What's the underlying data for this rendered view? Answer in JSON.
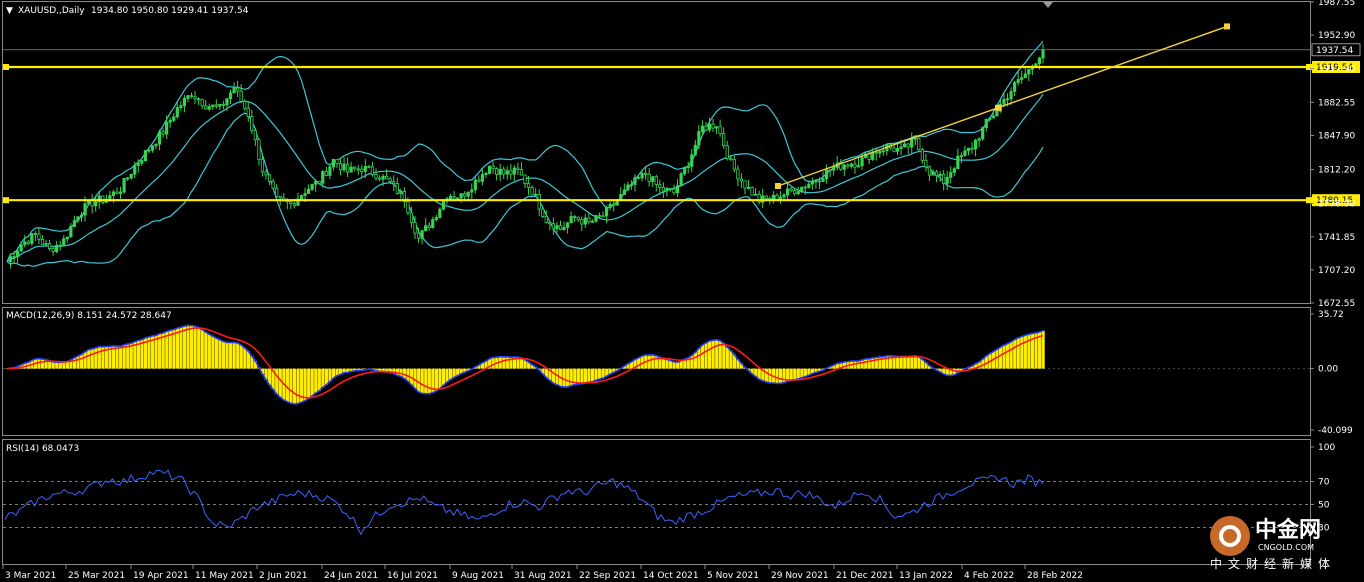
{
  "header": {
    "symbol_label": "XAUUSD,,Daily",
    "ohlc_label": "1934.80 1950.80 1929.41 1937.54",
    "macd_label": "MACD(12,26,9) 8.151 24.572 28.647",
    "rsi_label": "RSI(14) 68.0473"
  },
  "price_axis": {
    "ticks": [
      "1987.55",
      "1952.90",
      "1917.90",
      "1882.55",
      "1847.90",
      "1812.20",
      "1776.90",
      "1741.85",
      "1707.20",
      "1672.55"
    ],
    "tick_values": [
      1987.55,
      1952.9,
      1917.9,
      1882.55,
      1847.9,
      1812.2,
      1776.9,
      1741.85,
      1707.2,
      1672.55
    ],
    "current_label": "1937.54",
    "current_value": 1937.54,
    "level_high_label": "1919.54",
    "level_high_value": 1919.54,
    "level_low_label": "1780.15",
    "level_low_value": 1780.15
  },
  "macd_axis": {
    "ticks": [
      "35.72",
      "0.00",
      "-40.099"
    ],
    "values": [
      35.72,
      0,
      -40.099
    ]
  },
  "rsi_axis": {
    "ticks": [
      "100",
      "70",
      "50",
      "30"
    ],
    "values": [
      100,
      70,
      50,
      30
    ]
  },
  "date_axis": [
    "3 Mar 2021",
    "25 Mar 2021",
    "19 Apr 2021",
    "11 May 2021",
    "2 Jun 2021",
    "24 Jun 2021",
    "16 Jul 2021",
    "9 Aug 2021",
    "31 Aug 2021",
    "22 Sep 2021",
    "14 Oct 2021",
    "5 Nov 2021",
    "29 Nov 2021",
    "21 Dec 2021",
    "13 Jan 2022",
    "4 Feb 2022",
    "28 Feb 2022"
  ],
  "watermark": {
    "brand_cn": "中金网",
    "brand_en": "CNGOLD.COM",
    "sub_cn": "中文财经新媒体"
  },
  "colors": {
    "background": "#000000",
    "grid": "#3a3a3a",
    "candles": "#39d353",
    "bollinger": "#3cc8d8",
    "level_lines": "#ffee00",
    "trendline": "#f5d23c",
    "macd_hist": "#ffee00",
    "macd_line": "#1e3cff",
    "signal_line": "#ff1a1a",
    "rsi_line": "#3b63ff"
  },
  "chart_data": {
    "type": "candlestick",
    "symbol": "XAUUSD",
    "timeframe": "Daily",
    "ohlc_last": {
      "open": 1934.8,
      "high": 1950.8,
      "low": 1929.41,
      "close": 1937.54
    },
    "x_dates": [
      "3 Mar 2021",
      "25 Mar 2021",
      "19 Apr 2021",
      "11 May 2021",
      "2 Jun 2021",
      "24 Jun 2021",
      "16 Jul 2021",
      "9 Aug 2021",
      "31 Aug 2021",
      "22 Sep 2021",
      "14 Oct 2021",
      "5 Nov 2021",
      "29 Nov 2021",
      "21 Dec 2021",
      "13 Jan 2022",
      "4 Feb 2022",
      "28 Feb 2022"
    ],
    "close_approx": [
      1716,
      1734,
      1744,
      1728,
      1738,
      1766,
      1778,
      1782,
      1792,
      1816,
      1834,
      1852,
      1876,
      1892,
      1880,
      1876,
      1898,
      1870,
      1812,
      1780,
      1776,
      1790,
      1800,
      1822,
      1810,
      1814,
      1808,
      1798,
      1782,
      1740,
      1760,
      1786,
      1784,
      1800,
      1816,
      1808,
      1810,
      1790,
      1760,
      1750,
      1762,
      1756,
      1764,
      1780,
      1796,
      1808,
      1792,
      1788,
      1820,
      1856,
      1860,
      1818,
      1796,
      1780,
      1782,
      1788,
      1794,
      1802,
      1812,
      1818,
      1820,
      1830,
      1836,
      1832,
      1842,
      1810,
      1800,
      1822,
      1836,
      1860,
      1880,
      1900,
      1916,
      1938
    ],
    "ylim": [
      1672.55,
      1987.55
    ],
    "horizontal_levels": [
      1919.54,
      1780.15
    ],
    "trendline": {
      "start": [
        "29 Nov 2021",
        1795
      ],
      "end": [
        "28 Feb 2022",
        1962
      ]
    },
    "indicators": {
      "macd": {
        "params": "12,26,9",
        "values": [
          8.151,
          24.572,
          28.647
        ],
        "ylim": [
          -40.099,
          35.72
        ]
      },
      "rsi": {
        "period": 14,
        "value": 68.0473,
        "levels": [
          70,
          50,
          30
        ],
        "ylim": [
          0,
          100
        ]
      },
      "rsi_approx": [
        38,
        44,
        52,
        58,
        60,
        62,
        66,
        72,
        70,
        74,
        78,
        76,
        70,
        55,
        34,
        30,
        38,
        48,
        52,
        58,
        60,
        58,
        54,
        44,
        28,
        40,
        50,
        52,
        56,
        48,
        44,
        40,
        36,
        44,
        50,
        52,
        48,
        56,
        62,
        60,
        66,
        70,
        64,
        54,
        40,
        34,
        40,
        44,
        50,
        56,
        58,
        60,
        62,
        58,
        60,
        54,
        48,
        56,
        62,
        54,
        40,
        42,
        50,
        56,
        62,
        68,
        70,
        74,
        68,
        72,
        68
      ]
    }
  }
}
